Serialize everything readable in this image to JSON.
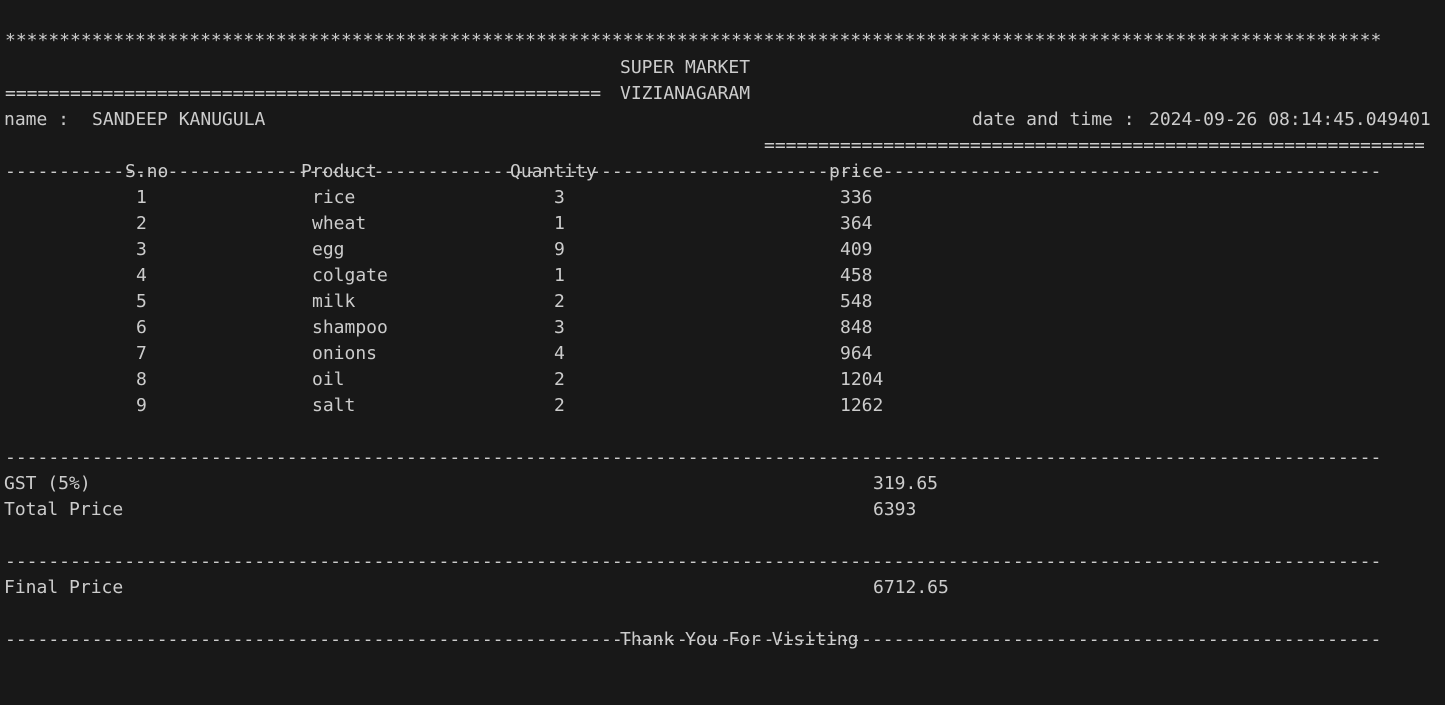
{
  "receipt": {
    "stars": "*******************************************************************************************************************************",
    "header_left_rule": "=======================================================",
    "store_name": "SUPER MARKET",
    "header_right_rule": "==============================================================",
    "city": "VIZIANAGARAM",
    "name_label": "name :",
    "customer_name": "SANDEEP KANUGULA",
    "datetime_label": "date and time :",
    "datetime_value": "2024-09-26 08:14:45.049401",
    "dash_rule": "-------------------------------------------------------------------------------------------------------------------------------",
    "columns": {
      "sno": "S.no",
      "product": "Product",
      "quantity": "Quantity",
      "price": "price"
    },
    "items": [
      {
        "sno": "1",
        "product": "rice",
        "quantity": "3",
        "price": "336"
      },
      {
        "sno": "2",
        "product": "wheat",
        "quantity": "1",
        "price": "364"
      },
      {
        "sno": "3",
        "product": "egg",
        "quantity": "9",
        "price": "409"
      },
      {
        "sno": "4",
        "product": "colgate",
        "quantity": "1",
        "price": "458"
      },
      {
        "sno": "5",
        "product": "milk",
        "quantity": "2",
        "price": "548"
      },
      {
        "sno": "6",
        "product": "shampoo",
        "quantity": "3",
        "price": "848"
      },
      {
        "sno": "7",
        "product": "onions",
        "quantity": "4",
        "price": "964"
      },
      {
        "sno": "8",
        "product": "oil",
        "quantity": "2",
        "price": "1204"
      },
      {
        "sno": "9",
        "product": "salt",
        "quantity": "2",
        "price": "1262"
      }
    ],
    "gst_label": "GST (5%)",
    "gst_value": "319.65",
    "total_label": "Total Price",
    "total_value": "6393",
    "final_label": "Final Price",
    "final_value": "6712.65",
    "thanks": "Thank You For Visiting"
  },
  "colors": {
    "background": "#181818",
    "text": "#cccccc"
  }
}
